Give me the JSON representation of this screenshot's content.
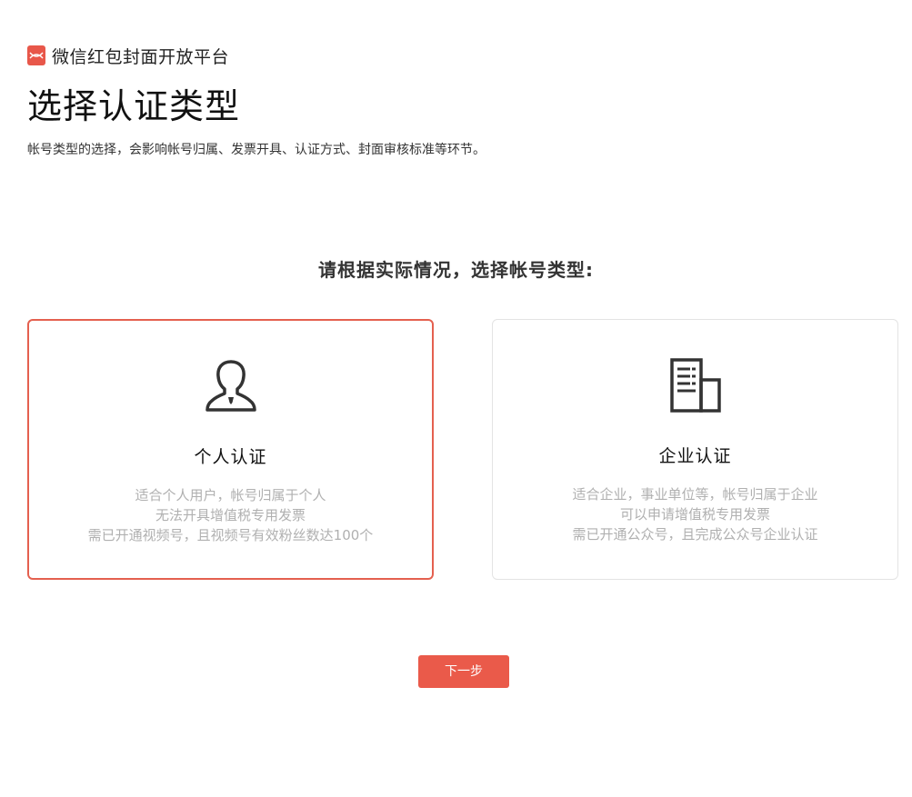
{
  "brand": {
    "name": "微信红包封面开放平台",
    "logo_icon": "red-packet-logo-icon",
    "accent_color": "#e8574a"
  },
  "header": {
    "title": "选择认证类型",
    "description": "帐号类型的选择，会影响帐号归属、发票开具、认证方式、封面审核标准等环节。"
  },
  "main": {
    "prompt": "请根据实际情况，选择帐号类型:",
    "options": [
      {
        "title": "个人认证",
        "icon": "person-icon",
        "selected": true,
        "lines": [
          "适合个人用户，帐号归属于个人",
          "无法开具增值税专用发票",
          "需已开通视频号，且视频号有效粉丝数达100个"
        ]
      },
      {
        "title": "企业认证",
        "icon": "building-icon",
        "selected": false,
        "lines": [
          "适合企业，事业单位等，帐号归属于企业",
          "可以申请增值税专用发票",
          "需已开通公众号，且完成公众号企业认证"
        ]
      }
    ],
    "selected_border_color": "#e4604f"
  },
  "footer": {
    "next_label": "下一步",
    "button_color": "#ea5a4a"
  }
}
